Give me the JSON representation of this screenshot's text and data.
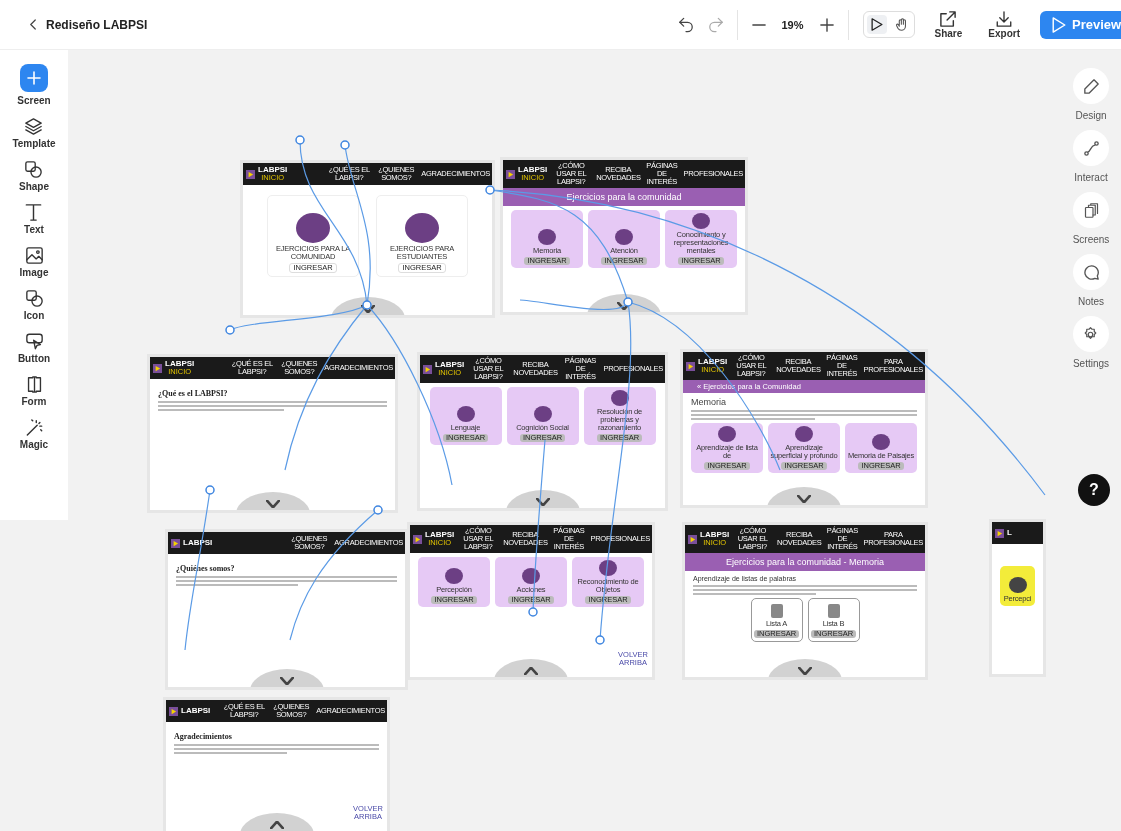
{
  "toolbar": {
    "title": "Rediseño LABPSI",
    "zoom": "19%",
    "share": "Share",
    "export": "Export",
    "preview": "Preview"
  },
  "modes": [
    {
      "kind": "play",
      "selected": true
    },
    {
      "kind": "hand",
      "selected": false
    }
  ],
  "tools": [
    {
      "kind": "screen",
      "label": "Screen"
    },
    {
      "kind": "template",
      "label": "Template"
    },
    {
      "kind": "shape",
      "label": "Shape"
    },
    {
      "kind": "text",
      "label": "Text"
    },
    {
      "kind": "image",
      "label": "Image"
    },
    {
      "kind": "icon",
      "label": "Icon"
    },
    {
      "kind": "button",
      "label": "Button"
    },
    {
      "kind": "form",
      "label": "Form"
    },
    {
      "kind": "magic",
      "label": "Magic"
    }
  ],
  "panels": [
    {
      "kind": "design",
      "label": "Design"
    },
    {
      "kind": "interact",
      "label": "Interact"
    },
    {
      "kind": "screens",
      "label": "Screens"
    },
    {
      "kind": "notes",
      "label": "Notes"
    },
    {
      "kind": "settings",
      "label": "Settings"
    }
  ],
  "help": "?",
  "screens": [
    {
      "nav": {
        "brand": "LABPSI",
        "brand_sub": "INICIO",
        "items": [
          "¿QUÉ ES EL LABPSI?",
          "¿QUIENES SOMOS?",
          "AGRADECIMIENTOS"
        ]
      },
      "cards": [
        {
          "kind": "outlined",
          "label": "EJERCICIOS PARA LA COMUNIDAD",
          "button": "INGRESAR"
        },
        {
          "kind": "outlined",
          "label": "EJERCICIOS PARA ESTUDIANTES",
          "button": "INGRESAR"
        }
      ],
      "scroll_down": true
    },
    {
      "nav": {
        "brand": "LABPSI",
        "brand_sub": "INICIO",
        "items": [
          "¿CÓMO USAR EL LABPSI?",
          "RECIBA NOVEDADES",
          "PÁGINAS DE INTERÉS",
          "PROFESIONALES"
        ]
      },
      "banner": "Ejercicios para la comunidad",
      "cards": [
        {
          "kind": "tile",
          "label": "Memoria",
          "button": "INGRESAR"
        },
        {
          "kind": "tile",
          "label": "Atención",
          "button": "INGRESAR"
        },
        {
          "kind": "tile",
          "label": "Conocimiento y representaciones mentales",
          "button": "INGRESAR"
        }
      ],
      "scroll_down": true
    },
    {
      "nav": {
        "brand": "LABPSI",
        "brand_sub": "INICIO",
        "items": [
          "¿QUÉ ES EL LABPSI?",
          "¿QUIENES SOMOS?",
          "AGRADECIMIENTOS"
        ]
      },
      "heading": {
        "kind": "serif",
        "text": "¿Qué es el LABPSI?"
      },
      "paragraph": true,
      "scroll_down": true
    },
    {
      "nav": {
        "brand": "LABPSI",
        "brand_sub": "INICIO",
        "items": [
          "¿CÓMO USAR EL LABPSI?",
          "RECIBA NOVEDADES",
          "PÁGINAS DE INTERÉS",
          "PROFESIONALES"
        ]
      },
      "cards": [
        {
          "kind": "tile",
          "label": "Lenguaje",
          "button": "INGRESAR"
        },
        {
          "kind": "tile",
          "label": "Cognición Social",
          "button": "INGRESAR"
        },
        {
          "kind": "tile",
          "label": "Resolución de problemas y razonamiento",
          "button": "INGRESAR"
        }
      ],
      "scroll_down": true
    },
    {
      "nav": {
        "brand": "LABPSI",
        "brand_sub": "INICIO",
        "items": [
          "¿CÓMO USAR EL LABPSI?",
          "RECIBA NOVEDADES",
          "PÁGINAS DE INTERÉS",
          "PARA PROFESIONALES"
        ]
      },
      "breadcrumb": "« Ejercicios para la Comunidad",
      "heading": {
        "kind": "sans",
        "text": "Memoria"
      },
      "paragraph": true,
      "cards": [
        {
          "kind": "tile",
          "label": "Aprendizaje de lista de",
          "button": "INGRESAR"
        },
        {
          "kind": "tile",
          "label": "Aprendizaje superficial y profundo",
          "button": "INGRESAR"
        },
        {
          "kind": "tile",
          "label": "Memoria de Paisajes",
          "button": "INGRESAR"
        }
      ],
      "scroll_down": true
    },
    {
      "nav": {
        "brand": "LABPSI",
        "items": [
          "¿QUIENES SOMOS?",
          "AGRADECIMIENTOS"
        ]
      },
      "heading": {
        "kind": "serif",
        "text": "¿Quiénes somos?"
      },
      "paragraph": true,
      "scroll_down": true
    },
    {
      "nav": {
        "brand": "LABPSI",
        "brand_sub": "INICIO",
        "items": [
          "¿CÓMO USAR EL LABPSI?",
          "RECIBA NOVEDADES",
          "PÁGINAS DE INTERÉS",
          "PROFESIONALES"
        ]
      },
      "cards": [
        {
          "kind": "tile",
          "label": "Percepción",
          "button": "INGRESAR"
        },
        {
          "kind": "tile",
          "label": "Acciones",
          "button": "INGRESAR"
        },
        {
          "kind": "tile",
          "label": "Reconocimiento de Objetos",
          "button": "INGRESAR"
        }
      ],
      "back_link": "VOLVER ARRIBA",
      "scroll_up": true
    },
    {
      "nav": {
        "brand": "LABPSI",
        "brand_sub": "INICIO",
        "items": [
          "¿CÓMO USAR EL LABPSI?",
          "RECIBA NOVEDADES",
          "PÁGINAS DE INTERÉS",
          "PARA PROFESIONALES"
        ]
      },
      "banner": "Ejercicios para la comunidad - Memoria",
      "subheading": "Aprendizaje de listas de palabras",
      "paragraph": true,
      "cards": [
        {
          "kind": "list",
          "label": "Lista A",
          "button": "INGRESAR"
        },
        {
          "kind": "list",
          "label": "Lista B",
          "button": "INGRESAR"
        }
      ],
      "scroll_down": true
    },
    {
      "nav": {
        "brand": "L"
      },
      "cards": [
        {
          "kind": "highlight",
          "label": "Percepci"
        }
      ]
    },
    {
      "nav": {
        "brand": "LABPSI",
        "items": [
          "¿QUÉ ES EL LABPSI?",
          "¿QUIENES SOMOS?",
          "AGRADECIMIENTOS"
        ]
      },
      "heading": {
        "kind": "serif",
        "text": "Agradecimientos"
      },
      "paragraph": true,
      "back_link": "VOLVER ARRIBA",
      "scroll_up": true
    }
  ]
}
